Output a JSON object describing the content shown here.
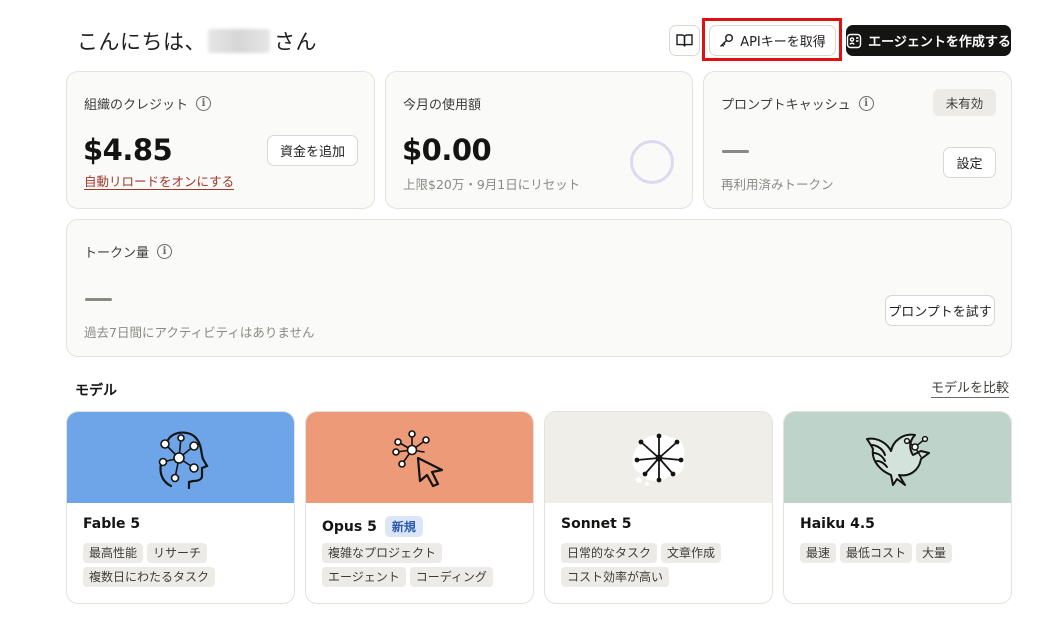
{
  "header": {
    "greeting_prefix": "こんにちは、",
    "greeting_suffix": "さん",
    "api_key_label": "APIキーを取得",
    "create_agent_label": "エージェントを作成する"
  },
  "credits": {
    "title": "組織のクレジット",
    "value": "$4.85",
    "add_funds_label": "資金を追加",
    "auto_reload_link": "自動リロードをオンにする"
  },
  "usage": {
    "title": "今月の使用額",
    "value": "$0.00",
    "limit_text": "上限$20万・9月1日にリセット"
  },
  "prompt_cache": {
    "title": "プロンプトキャッシュ",
    "status_badge": "未有効",
    "settings_label": "設定",
    "subtitle": "再利用済みトークン"
  },
  "tokens": {
    "title": "トークン量",
    "empty_text": "過去7日間にアクティビティはありません",
    "try_prompt_label": "プロンプトを試す"
  },
  "models_section": {
    "title": "モデル",
    "compare_link": "モデルを比較"
  },
  "models": [
    {
      "name": "Fable 5",
      "badge": "",
      "color": "#6ea5e8",
      "tags": [
        "最高性能",
        "リサーチ",
        "複数日にわたるタスク"
      ]
    },
    {
      "name": "Opus 5",
      "badge": "新規",
      "color": "#ec9a78",
      "tags": [
        "複雑なプロジェクト",
        "エージェント",
        "コーディング"
      ]
    },
    {
      "name": "Sonnet 5",
      "badge": "",
      "color": "#f0eee8",
      "tags": [
        "日常的なタスク",
        "文章作成",
        "コスト効率が高い"
      ]
    },
    {
      "name": "Haiku 4.5",
      "badge": "",
      "color": "#bed3ca",
      "tags": [
        "最速",
        "最低コスト",
        "大量"
      ]
    }
  ]
}
